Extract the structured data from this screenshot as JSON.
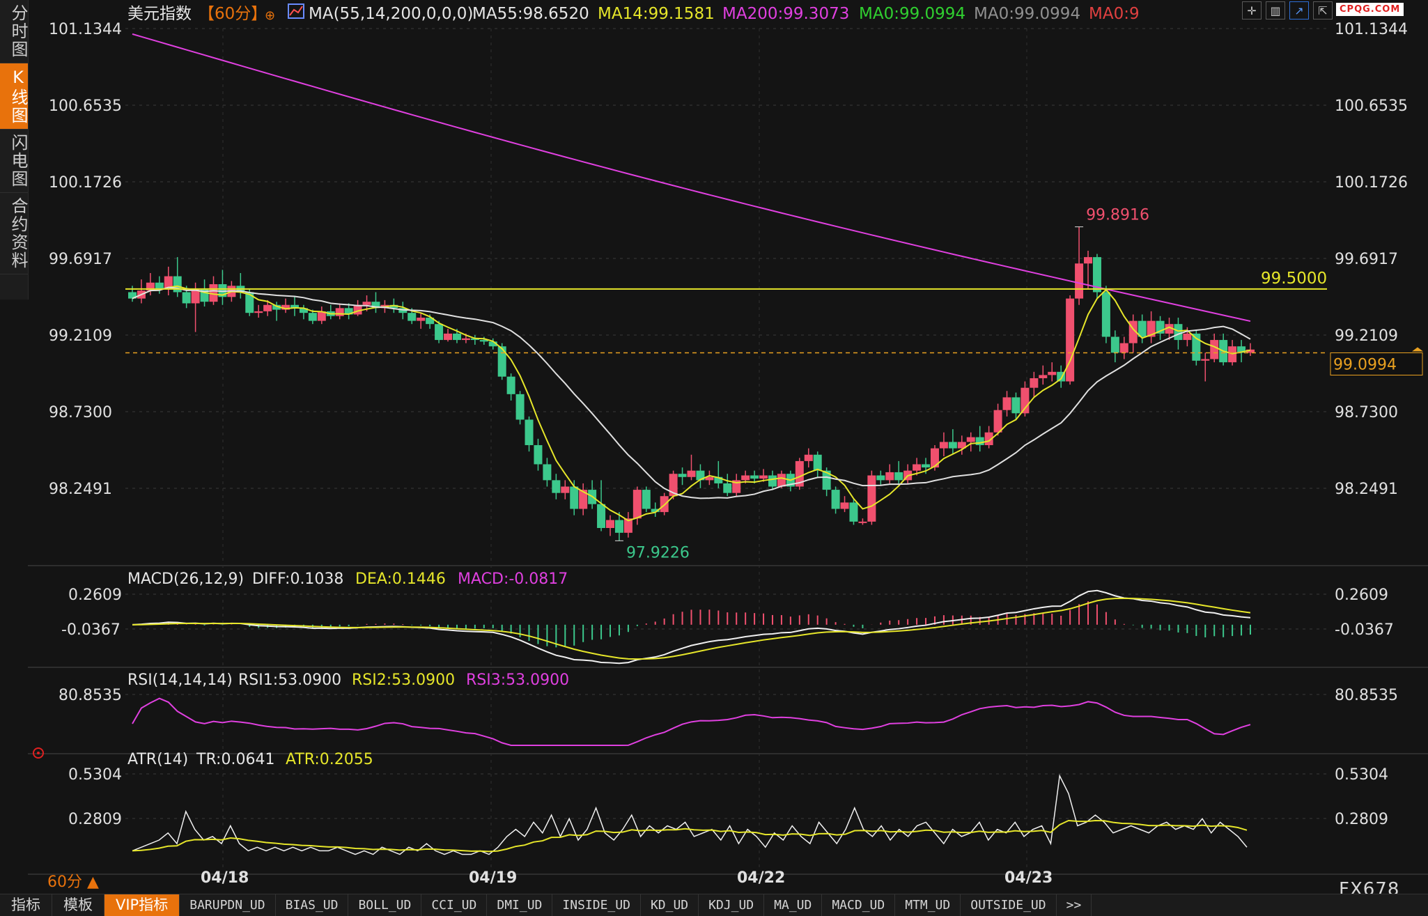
{
  "sidebar": {
    "tabs": [
      {
        "label": "分时图",
        "active": false
      },
      {
        "label": "K线图",
        "active": true
      },
      {
        "label": "闪电图",
        "active": false
      },
      {
        "label": "合约资料",
        "active": false
      }
    ]
  },
  "header": {
    "symbol": "美元指数",
    "period_tag": "【60分】",
    "ma_params": "MA(55,14,200,0,0,0)",
    "ma55": "MA55:98.6520",
    "ma14": "MA14:99.1581",
    "ma200": "MA200:99.3073",
    "ma0a": "MA0:99.0994",
    "ma0b": "MA0:99.0994",
    "ma0c": "MA0:9"
  },
  "logo": "CPQG.COM",
  "colors": {
    "background": "#141414",
    "up": "#f0506e",
    "down": "#3cc88c",
    "ma14": "#e6e62a",
    "ma55": "#e0e0e0",
    "ma200": "#e040e0",
    "ma0": "#30d030",
    "accent": "#e8720c"
  },
  "chart_data": [
    {
      "type": "candlestick",
      "name_label": "美元指数 60分",
      "y_ticks": [
        "101.1344",
        "100.6535",
        "100.1726",
        "99.6917",
        "99.2109",
        "98.7300",
        "98.2491"
      ],
      "x_ticks": [
        "04/18",
        "04/19",
        "04/22",
        "04/23"
      ],
      "ylim": [
        97.85,
        101.2
      ],
      "high_label": "99.8916",
      "low_label": "97.9226",
      "horizontal_line": {
        "value": 99.5,
        "label": "99.5000"
      },
      "last_price": {
        "value": 99.0994,
        "label": "99.0994"
      },
      "candles": [
        [
          99.48,
          99.44,
          99.52,
          99.42
        ],
        [
          99.44,
          99.49,
          99.56,
          99.41
        ],
        [
          99.49,
          99.54,
          99.6,
          99.46
        ],
        [
          99.54,
          99.5,
          99.58,
          99.47
        ],
        [
          99.5,
          99.58,
          99.64,
          99.46
        ],
        [
          99.58,
          99.48,
          99.7,
          99.45
        ],
        [
          99.48,
          99.41,
          99.52,
          99.38
        ],
        [
          99.41,
          99.5,
          99.54,
          99.23
        ],
        [
          99.5,
          99.42,
          99.56,
          99.39
        ],
        [
          99.42,
          99.53,
          99.58,
          99.4
        ],
        [
          99.53,
          99.45,
          99.62,
          99.4
        ],
        [
          99.45,
          99.52,
          99.55,
          99.42
        ],
        [
          99.52,
          99.48,
          99.6,
          99.44
        ],
        [
          99.48,
          99.35,
          99.5,
          99.33
        ],
        [
          99.35,
          99.36,
          99.4,
          99.32
        ],
        [
          99.36,
          99.4,
          99.43,
          99.33
        ],
        [
          99.4,
          99.37,
          99.42,
          99.3
        ],
        [
          99.37,
          99.4,
          99.44,
          99.35
        ],
        [
          99.4,
          99.38,
          99.45,
          99.33
        ],
        [
          99.38,
          99.35,
          99.4,
          99.31
        ],
        [
          99.35,
          99.3,
          99.37,
          99.28
        ],
        [
          99.3,
          99.36,
          99.39,
          99.28
        ],
        [
          99.36,
          99.33,
          99.4,
          99.31
        ],
        [
          99.33,
          99.38,
          99.41,
          99.31
        ],
        [
          99.38,
          99.34,
          99.41,
          99.31
        ],
        [
          99.34,
          99.4,
          99.43,
          99.33
        ],
        [
          99.4,
          99.42,
          99.46,
          99.36
        ],
        [
          99.42,
          99.38,
          99.48,
          99.35
        ],
        [
          99.38,
          99.4,
          99.43,
          99.35
        ],
        [
          99.4,
          99.38,
          99.44,
          99.35
        ],
        [
          99.38,
          99.35,
          99.42,
          99.31
        ],
        [
          99.35,
          99.3,
          99.38,
          99.28
        ],
        [
          99.3,
          99.32,
          99.35,
          99.25
        ],
        [
          99.32,
          99.28,
          99.34,
          99.25
        ],
        [
          99.28,
          99.18,
          99.3,
          99.16
        ],
        [
          99.18,
          99.22,
          99.25,
          99.17
        ],
        [
          99.22,
          99.18,
          99.25,
          99.16
        ],
        [
          99.18,
          99.19,
          99.22,
          99.16
        ],
        [
          99.19,
          99.18,
          99.21,
          99.15
        ],
        [
          99.18,
          99.17,
          99.2,
          99.15
        ],
        [
          99.17,
          99.14,
          99.19,
          99.12
        ],
        [
          99.14,
          98.95,
          99.16,
          98.93
        ],
        [
          98.95,
          98.84,
          98.97,
          98.8
        ],
        [
          98.84,
          98.68,
          98.86,
          98.65
        ],
        [
          98.68,
          98.52,
          98.7,
          98.48
        ],
        [
          98.52,
          98.4,
          98.56,
          98.36
        ],
        [
          98.4,
          98.3,
          98.44,
          98.26
        ],
        [
          98.3,
          98.22,
          98.34,
          98.18
        ],
        [
          98.22,
          98.26,
          98.3,
          98.18
        ],
        [
          98.26,
          98.12,
          98.3,
          98.08
        ],
        [
          98.12,
          98.24,
          98.28,
          98.08
        ],
        [
          98.24,
          98.15,
          98.3,
          98.12
        ],
        [
          98.15,
          98.0,
          98.3,
          97.98
        ],
        [
          98.0,
          98.05,
          98.08,
          97.95
        ],
        [
          98.05,
          97.97,
          98.1,
          97.92
        ],
        [
          97.97,
          98.06,
          98.1,
          97.94
        ],
        [
          98.06,
          98.24,
          98.26,
          98.02
        ],
        [
          98.24,
          98.12,
          98.26,
          98.1
        ],
        [
          98.12,
          98.1,
          98.16,
          98.07
        ],
        [
          98.1,
          98.2,
          98.22,
          98.08
        ],
        [
          98.2,
          98.34,
          98.36,
          98.18
        ],
        [
          98.34,
          98.32,
          98.38,
          98.27
        ],
        [
          98.32,
          98.36,
          98.46,
          98.3
        ],
        [
          98.36,
          98.3,
          98.4,
          98.25
        ],
        [
          98.3,
          98.32,
          98.36,
          98.27
        ],
        [
          98.32,
          98.28,
          98.42,
          98.25
        ],
        [
          98.28,
          98.22,
          98.34,
          98.2
        ],
        [
          98.22,
          98.3,
          98.34,
          98.2
        ],
        [
          98.3,
          98.33,
          98.36,
          98.28
        ],
        [
          98.33,
          98.31,
          98.36,
          98.28
        ],
        [
          98.31,
          98.33,
          98.37,
          98.29
        ],
        [
          98.33,
          98.26,
          98.36,
          98.24
        ],
        [
          98.26,
          98.34,
          98.36,
          98.25
        ],
        [
          98.34,
          98.26,
          98.36,
          98.23
        ],
        [
          98.26,
          98.42,
          98.44,
          98.24
        ],
        [
          98.42,
          98.46,
          98.5,
          98.38
        ],
        [
          98.46,
          98.36,
          98.48,
          98.32
        ],
        [
          98.36,
          98.24,
          98.38,
          98.2
        ],
        [
          98.24,
          98.12,
          98.26,
          98.09
        ],
        [
          98.12,
          98.16,
          98.2,
          98.1
        ],
        [
          98.16,
          98.04,
          98.18,
          98.02
        ],
        [
          98.04,
          98.04,
          98.06,
          98.02
        ],
        [
          98.04,
          98.33,
          98.36,
          98.02
        ],
        [
          98.33,
          98.3,
          98.36,
          98.27
        ],
        [
          98.3,
          98.35,
          98.4,
          98.28
        ],
        [
          98.35,
          98.3,
          98.42,
          98.27
        ],
        [
          98.3,
          98.36,
          98.4,
          98.28
        ],
        [
          98.36,
          98.4,
          98.44,
          98.33
        ],
        [
          98.4,
          98.38,
          98.44,
          98.34
        ],
        [
          98.38,
          98.5,
          98.52,
          98.36
        ],
        [
          98.5,
          98.54,
          98.6,
          98.45
        ],
        [
          98.54,
          98.5,
          98.62,
          98.46
        ],
        [
          98.5,
          98.54,
          98.58,
          98.46
        ],
        [
          98.54,
          98.57,
          98.6,
          98.48
        ],
        [
          98.57,
          98.52,
          98.64,
          98.48
        ],
        [
          98.52,
          98.6,
          98.64,
          98.5
        ],
        [
          98.6,
          98.74,
          98.78,
          98.58
        ],
        [
          98.74,
          98.82,
          98.86,
          98.7
        ],
        [
          98.82,
          98.72,
          98.85,
          98.68
        ],
        [
          98.72,
          98.88,
          98.92,
          98.7
        ],
        [
          98.88,
          98.94,
          98.98,
          98.82
        ],
        [
          98.94,
          98.96,
          99.02,
          98.9
        ],
        [
          98.96,
          98.98,
          99.04,
          98.92
        ],
        [
          98.98,
          98.92,
          99.02,
          98.88
        ],
        [
          98.92,
          99.44,
          99.46,
          98.9
        ],
        [
          99.44,
          99.66,
          99.89,
          99.4
        ],
        [
          99.66,
          99.7,
          99.74,
          99.5
        ],
        [
          99.7,
          99.48,
          99.72,
          99.44
        ],
        [
          99.48,
          99.2,
          99.52,
          99.16
        ],
        [
          99.2,
          99.1,
          99.24,
          99.04
        ],
        [
          99.1,
          99.16,
          99.2,
          99.06
        ],
        [
          99.16,
          99.3,
          99.34,
          99.1
        ],
        [
          99.3,
          99.2,
          99.34,
          99.16
        ],
        [
          99.2,
          99.3,
          99.36,
          99.16
        ],
        [
          99.3,
          99.22,
          99.33,
          99.18
        ],
        [
          99.22,
          99.28,
          99.32,
          99.18
        ],
        [
          99.28,
          99.18,
          99.32,
          99.12
        ],
        [
          99.18,
          99.22,
          99.26,
          99.14
        ],
        [
          99.22,
          99.05,
          99.24,
          99.02
        ],
        [
          99.05,
          99.06,
          99.1,
          98.92
        ],
        [
          99.06,
          99.18,
          99.22,
          99.04
        ],
        [
          99.18,
          99.04,
          99.22,
          99.02
        ],
        [
          99.04,
          99.14,
          99.18,
          99.02
        ],
        [
          99.14,
          99.1,
          99.18,
          99.04
        ],
        [
          99.1,
          99.12,
          99.16,
          99.08
        ]
      ]
    },
    {
      "type": "line",
      "name": "MACD",
      "header": "MACD(26,12,9)",
      "diff_label": "DIFF:0.1038",
      "dea_label": "DEA:0.1446",
      "macd_label": "MACD:-0.0817",
      "y_ticks": [
        "0.2609",
        "-0.0367"
      ],
      "ylim": [
        -0.36,
        0.32
      ]
    },
    {
      "type": "line",
      "name": "RSI",
      "header": "RSI(14,14,14)",
      "rsi1_label": "RSI1:53.0900",
      "rsi2_label": "RSI2:53.0900",
      "rsi3_label": "RSI3:53.0900",
      "y_ticks": [
        "80.8535"
      ]
    },
    {
      "type": "line",
      "name": "ATR",
      "header": "ATR(14)",
      "tr_label": "TR:0.0641",
      "atr_label": "ATR:0.2055",
      "y_ticks": [
        "0.5304",
        "0.2809"
      ],
      "ylim": [
        0.02,
        0.58
      ],
      "tr": [
        0.1,
        0.12,
        0.14,
        0.16,
        0.2,
        0.14,
        0.32,
        0.22,
        0.16,
        0.18,
        0.14,
        0.24,
        0.14,
        0.1,
        0.12,
        0.1,
        0.12,
        0.1,
        0.12,
        0.1,
        0.12,
        0.1,
        0.1,
        0.12,
        0.1,
        0.08,
        0.1,
        0.08,
        0.12,
        0.1,
        0.08,
        0.12,
        0.1,
        0.14,
        0.1,
        0.08,
        0.1,
        0.08,
        0.08,
        0.1,
        0.08,
        0.12,
        0.18,
        0.22,
        0.18,
        0.26,
        0.2,
        0.3,
        0.18,
        0.28,
        0.16,
        0.22,
        0.34,
        0.2,
        0.16,
        0.22,
        0.3,
        0.18,
        0.24,
        0.2,
        0.24,
        0.22,
        0.26,
        0.18,
        0.2,
        0.22,
        0.16,
        0.24,
        0.14,
        0.22,
        0.18,
        0.12,
        0.2,
        0.16,
        0.24,
        0.18,
        0.14,
        0.26,
        0.2,
        0.14,
        0.22,
        0.34,
        0.22,
        0.18,
        0.24,
        0.16,
        0.22,
        0.18,
        0.24,
        0.26,
        0.2,
        0.14,
        0.22,
        0.18,
        0.2,
        0.26,
        0.16,
        0.22,
        0.2,
        0.26,
        0.18,
        0.22,
        0.24,
        0.14,
        0.52,
        0.42,
        0.24,
        0.26,
        0.3,
        0.26,
        0.2,
        0.22,
        0.24,
        0.22,
        0.2,
        0.24,
        0.26,
        0.22,
        0.24,
        0.22,
        0.28,
        0.2,
        0.26,
        0.22,
        0.18,
        0.12
      ]
    }
  ],
  "footer": {
    "period_label": "60分",
    "brand": "FX678",
    "tabs": [
      {
        "label": "指标",
        "active": false,
        "small": false
      },
      {
        "label": "模板",
        "active": false,
        "small": false
      },
      {
        "label": "VIP指标",
        "active": true,
        "small": false
      },
      {
        "label": "BARUPDN_UD",
        "active": false,
        "small": true
      },
      {
        "label": "BIAS_UD",
        "active": false,
        "small": true
      },
      {
        "label": "BOLL_UD",
        "active": false,
        "small": true
      },
      {
        "label": "CCI_UD",
        "active": false,
        "small": true
      },
      {
        "label": "DMI_UD",
        "active": false,
        "small": true
      },
      {
        "label": "INSIDE_UD",
        "active": false,
        "small": true
      },
      {
        "label": "KD_UD",
        "active": false,
        "small": true
      },
      {
        "label": "KDJ_UD",
        "active": false,
        "small": true
      },
      {
        "label": "MA_UD",
        "active": false,
        "small": true
      },
      {
        "label": "MACD_UD",
        "active": false,
        "small": true
      },
      {
        "label": "MTM_UD",
        "active": false,
        "small": true
      },
      {
        "label": "OUTSIDE_UD",
        "active": false,
        "small": true
      },
      {
        "label": ">>",
        "active": false,
        "small": true
      }
    ]
  },
  "toolbar_icons": [
    "crosshair-icon",
    "bar-chart-icon",
    "line-chart-icon",
    "export-icon"
  ]
}
